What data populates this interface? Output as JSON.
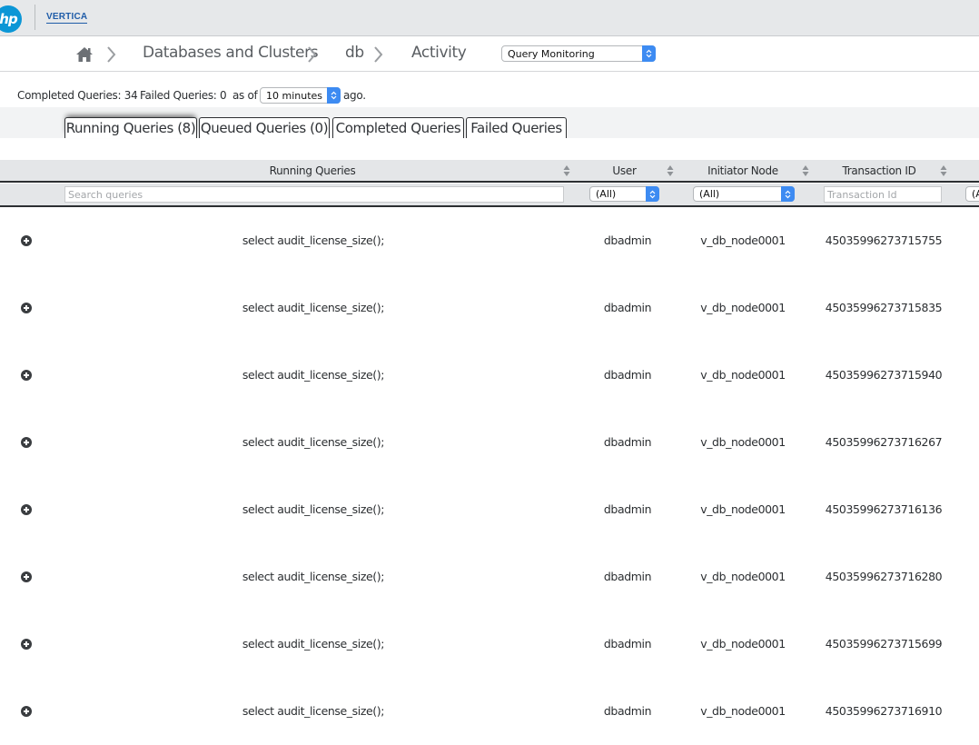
{
  "brand": {
    "hp_logo": "hp",
    "vertica_logo": "VERTICA"
  },
  "breadcrumb": {
    "home_icon": "home-icon",
    "separator_icon": "chevron-right-icon",
    "items": [
      "Databases and Clusters",
      "db",
      "Activity"
    ],
    "view_select": {
      "value": "Query Monitoring"
    }
  },
  "summary": {
    "completed_label": "Completed Queries: 34",
    "failed_label": "Failed Queries: 0",
    "as_of_label": "as of",
    "time_select": {
      "value": "10 minutes"
    },
    "ago_label": "ago."
  },
  "tabs": [
    {
      "label": "Running Queries (8)",
      "active": true
    },
    {
      "label": "Queued Queries (0)",
      "active": false
    },
    {
      "label": "Completed Queries",
      "active": false
    },
    {
      "label": "Failed Queries",
      "active": false
    }
  ],
  "table": {
    "columns": [
      {
        "label": "Running Queries"
      },
      {
        "label": "User"
      },
      {
        "label": "Initiator Node"
      },
      {
        "label": "Transaction ID"
      }
    ],
    "sort_icon": "sort-updown-icon",
    "filters": {
      "search_placeholder": "Search queries",
      "user_select": "(All)",
      "node_select": "(All)",
      "transaction_placeholder": "Transaction Id",
      "next_select": "(A"
    },
    "expand_icon": "plus-circle-icon",
    "rows": [
      {
        "query": "select audit_license_size();",
        "user": "dbadmin",
        "node": "v_db_node0001",
        "transaction_id": "45035996273715755"
      },
      {
        "query": "select audit_license_size();",
        "user": "dbadmin",
        "node": "v_db_node0001",
        "transaction_id": "45035996273715835"
      },
      {
        "query": "select audit_license_size();",
        "user": "dbadmin",
        "node": "v_db_node0001",
        "transaction_id": "45035996273715940"
      },
      {
        "query": "select audit_license_size();",
        "user": "dbadmin",
        "node": "v_db_node0001",
        "transaction_id": "45035996273716267"
      },
      {
        "query": "select audit_license_size();",
        "user": "dbadmin",
        "node": "v_db_node0001",
        "transaction_id": "45035996273716136"
      },
      {
        "query": "select audit_license_size();",
        "user": "dbadmin",
        "node": "v_db_node0001",
        "transaction_id": "45035996273716280"
      },
      {
        "query": "select audit_license_size();",
        "user": "dbadmin",
        "node": "v_db_node0001",
        "transaction_id": "45035996273715699"
      },
      {
        "query": "select audit_license_size();",
        "user": "dbadmin",
        "node": "v_db_node0001",
        "transaction_id": "45035996273716910"
      }
    ]
  },
  "colors": {
    "hp_blue": "#0b96d6",
    "vertica_blue": "#1f5ca8",
    "select_accent": "#3d8bf2",
    "header_bg": "#e4e6e8"
  }
}
